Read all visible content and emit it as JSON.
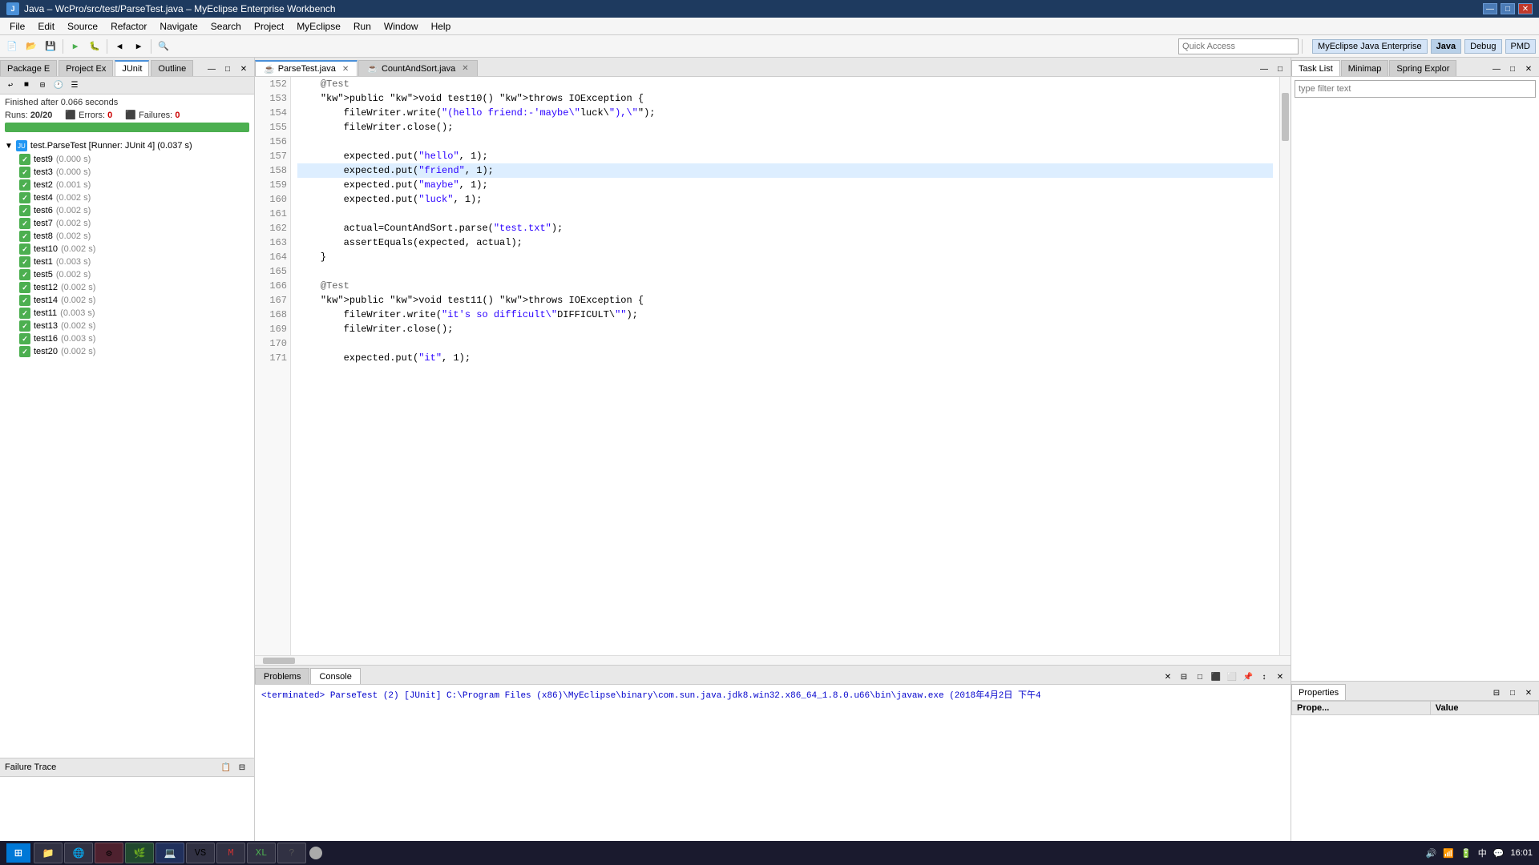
{
  "titlebar": {
    "icon": "J",
    "title": "Java – WcPro/src/test/ParseTest.java – MyEclipse Enterprise Workbench",
    "min_btn": "—",
    "max_btn": "□",
    "close_btn": "✕"
  },
  "menubar": {
    "items": [
      "File",
      "Edit",
      "Source",
      "Refactor",
      "Navigate",
      "Search",
      "Project",
      "MyEclipse",
      "Run",
      "Window",
      "Help"
    ]
  },
  "toolbar": {
    "quick_access_placeholder": "Quick Access",
    "perspectives": [
      "MyEclipse Java Enterprise",
      "Java",
      "Debug",
      "PMD"
    ]
  },
  "left_panel": {
    "tabs": [
      "Package E",
      "Project Ex",
      "JUnit",
      "Outline"
    ],
    "active_tab": "JUnit",
    "finished_text": "Finished after 0.066 seconds",
    "runs_label": "Runs:",
    "runs_value": "20/20",
    "errors_label": "Errors:",
    "errors_value": "0",
    "failures_label": "Failures:",
    "failures_value": "0",
    "progress_percent": 100,
    "test_suite": "test.ParseTest [Runner: JUnit 4] (0.037 s)",
    "tests": [
      {
        "name": "test9",
        "time": "(0.000 s)"
      },
      {
        "name": "test3",
        "time": "(0.000 s)"
      },
      {
        "name": "test2",
        "time": "(0.001 s)"
      },
      {
        "name": "test4",
        "time": "(0.002 s)"
      },
      {
        "name": "test6",
        "time": "(0.002 s)"
      },
      {
        "name": "test7",
        "time": "(0.002 s)"
      },
      {
        "name": "test8",
        "time": "(0.002 s)"
      },
      {
        "name": "test10",
        "time": "(0.002 s)"
      },
      {
        "name": "test1",
        "time": "(0.003 s)"
      },
      {
        "name": "test5",
        "time": "(0.002 s)"
      },
      {
        "name": "test12",
        "time": "(0.002 s)"
      },
      {
        "name": "test14",
        "time": "(0.002 s)"
      },
      {
        "name": "test11",
        "time": "(0.003 s)"
      },
      {
        "name": "test13",
        "time": "(0.002 s)"
      },
      {
        "name": "test16",
        "time": "(0.003 s)"
      },
      {
        "name": "test20",
        "time": "(0.002 s)"
      }
    ],
    "failure_trace_label": "Failure Trace"
  },
  "editor": {
    "tabs": [
      "ParseTest.java",
      "CountAndSort.java"
    ],
    "active_tab": "ParseTest.java",
    "lines": [
      {
        "num": 152,
        "content": "    @Test",
        "type": "annotation"
      },
      {
        "num": 153,
        "content": "    public void test10() throws IOException {",
        "type": "code"
      },
      {
        "num": 154,
        "content": "        fileWriter.write(\"(hello friend:-'maybe\\\"luck\\\"),\\\"\");",
        "type": "code"
      },
      {
        "num": 155,
        "content": "        fileWriter.close();",
        "type": "code"
      },
      {
        "num": 156,
        "content": "",
        "type": "empty"
      },
      {
        "num": 157,
        "content": "        expected.put(\"hello\", 1);",
        "type": "code"
      },
      {
        "num": 158,
        "content": "        expected.put(\"friend\", 1);",
        "type": "code",
        "highlighted": true
      },
      {
        "num": 159,
        "content": "        expected.put(\"maybe\", 1);",
        "type": "code"
      },
      {
        "num": 160,
        "content": "        expected.put(\"luck\", 1);",
        "type": "code"
      },
      {
        "num": 161,
        "content": "",
        "type": "empty"
      },
      {
        "num": 162,
        "content": "        actual=CountAndSort.parse(\"test.txt\");",
        "type": "code"
      },
      {
        "num": 163,
        "content": "        assertEquals(expected, actual);",
        "type": "code"
      },
      {
        "num": 164,
        "content": "    }",
        "type": "code"
      },
      {
        "num": 165,
        "content": "",
        "type": "empty"
      },
      {
        "num": 166,
        "content": "    @Test",
        "type": "annotation"
      },
      {
        "num": 167,
        "content": "    public void test11() throws IOException {",
        "type": "code"
      },
      {
        "num": 168,
        "content": "        fileWriter.write(\"it's so difficult\\\"DIFFICULT\\\"\");",
        "type": "code"
      },
      {
        "num": 169,
        "content": "        fileWriter.close();",
        "type": "code"
      },
      {
        "num": 170,
        "content": "",
        "type": "empty"
      },
      {
        "num": 171,
        "content": "        expected.put(\"it\", 1);",
        "type": "code"
      }
    ]
  },
  "console": {
    "tabs": [
      "Problems",
      "Console"
    ],
    "active_tab": "Console",
    "terminated_text": "<terminated> ParseTest (2) [JUnit] C:\\Program Files (x86)\\MyEclipse\\binary\\com.sun.java.jdk8.win32.x86_64_1.8.0.u66\\bin\\javaw.exe (2018年4月2日 下午4"
  },
  "right_panel": {
    "top_tabs": [
      "Task List",
      "Minimap",
      "Spring Explor"
    ],
    "active_top_tab": "Task List",
    "filter_placeholder": "type filter text",
    "bottom_tabs": [
      "Properties"
    ],
    "active_bottom_tab": "Properties",
    "prop_headers": [
      "Prope...",
      "Value"
    ]
  }
}
